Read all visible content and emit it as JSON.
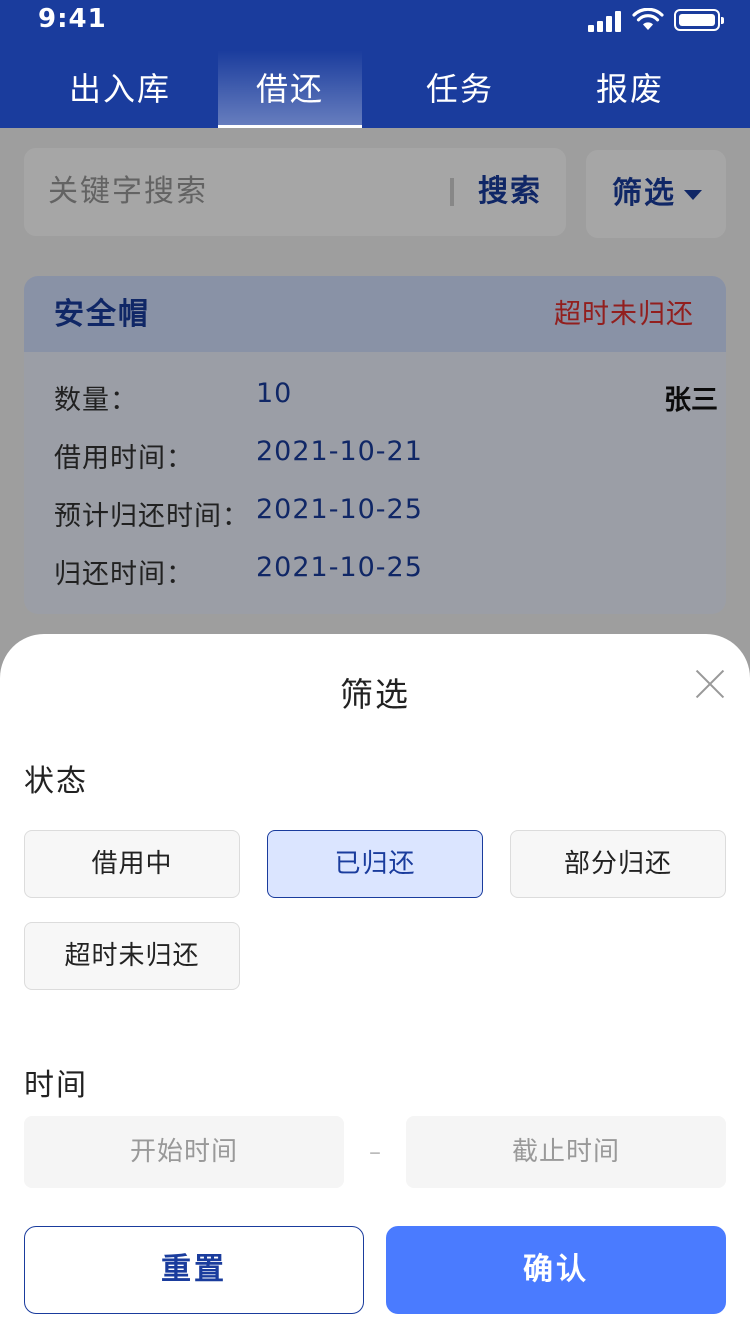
{
  "status_bar": {
    "time": "9:41"
  },
  "tabs": [
    {
      "label": "出入库",
      "active": false
    },
    {
      "label": "借还",
      "active": true
    },
    {
      "label": "任务",
      "active": false
    },
    {
      "label": "报废",
      "active": false
    }
  ],
  "search": {
    "placeholder": "关键字搜索",
    "button_label": "搜索"
  },
  "filter": {
    "label": "筛选"
  },
  "card": {
    "title": "安全帽",
    "status": "超时未归还",
    "person": "张三",
    "rows": [
      {
        "label": "数量：",
        "value": "10"
      },
      {
        "label": "借用时间：",
        "value": "2021-10-21"
      },
      {
        "label": "预计归还时间：",
        "value": "2021-10-25"
      },
      {
        "label": "归还时间：",
        "value": "2021-10-25"
      }
    ]
  },
  "sheet": {
    "title": "筛选",
    "status_label": "状态",
    "status_options": [
      {
        "label": "借用中",
        "selected": false
      },
      {
        "label": "已归还",
        "selected": true
      },
      {
        "label": "部分归还",
        "selected": false
      },
      {
        "label": "超时未归还",
        "selected": false
      }
    ],
    "time_label": "时间",
    "start_placeholder": "开始时间",
    "end_placeholder": "截止时间",
    "dash": "–",
    "reset_label": "重置",
    "confirm_label": "确认"
  },
  "colors": {
    "primary": "#1a3c9d",
    "accent": "#4a7bff",
    "danger": "#e0302f"
  }
}
